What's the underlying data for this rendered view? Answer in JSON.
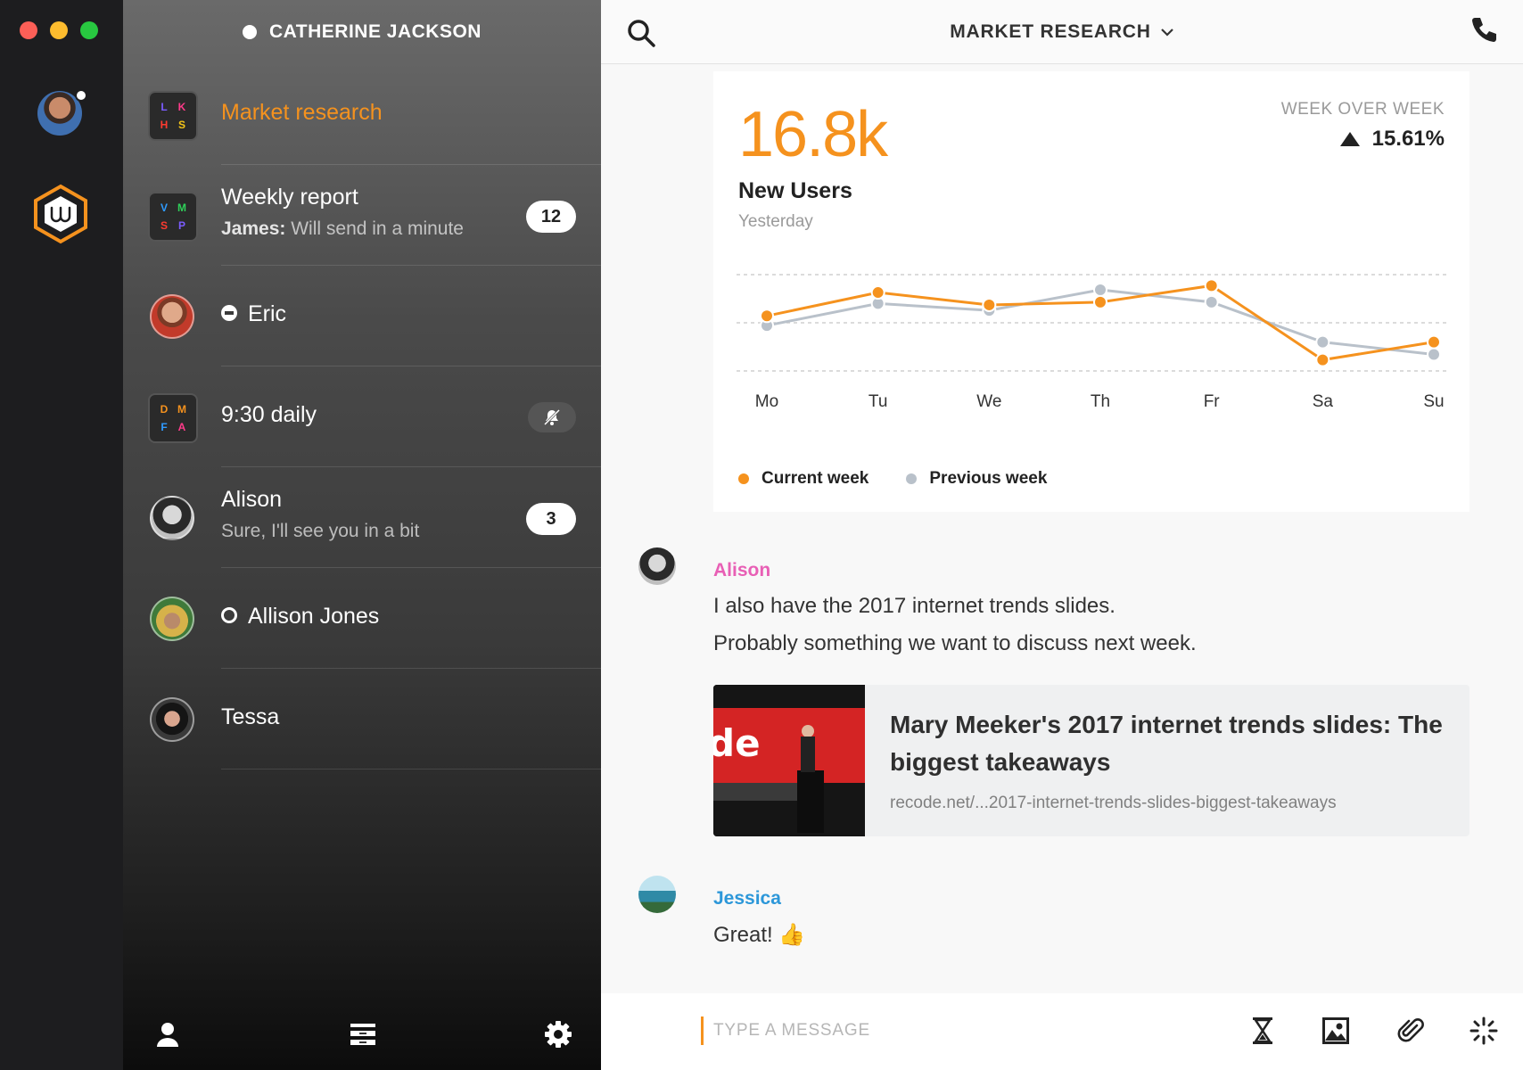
{
  "window": {
    "traffic_lights": [
      "close",
      "minimize",
      "zoom"
    ]
  },
  "rail": {
    "avatar_icon": "user-avatar",
    "logo_icon": "wire-logo-icon",
    "accent": "#f5921e"
  },
  "sidebar": {
    "header": {
      "user_name": "CATHERINE JACKSON"
    },
    "conversations": [
      {
        "type": "group",
        "title": "Market research",
        "active": true,
        "initials": [
          "L",
          "K",
          "H",
          "S"
        ],
        "initial_colors": [
          "#7b5cff",
          "#ff3b8a",
          "#ff3b30",
          "#f5c518"
        ]
      },
      {
        "type": "group",
        "title": "Weekly report",
        "sender": "James:",
        "preview": "Will send in a minute",
        "unread": "12",
        "initials": [
          "V",
          "M",
          "S",
          "P"
        ],
        "initial_colors": [
          "#2f9bff",
          "#2ed159",
          "#ff3b30",
          "#7b5cff"
        ]
      },
      {
        "type": "person",
        "title": "Eric",
        "presence": "do-not-disturb"
      },
      {
        "type": "group",
        "title": "9:30 daily",
        "muted": true,
        "initials": [
          "D",
          "M",
          "F",
          "A"
        ],
        "initial_colors": [
          "#f5921e",
          "#f5921e",
          "#2f9bff",
          "#ff3b8a"
        ]
      },
      {
        "type": "person",
        "title": "Alison",
        "preview": "Sure, I'll see you in a bit",
        "unread": "3"
      },
      {
        "type": "person",
        "title": "Allison Jones",
        "presence": "away"
      },
      {
        "type": "person",
        "title": "Tessa"
      }
    ],
    "footer": {
      "icons": [
        "person-icon",
        "archive-icon",
        "gear-icon"
      ]
    }
  },
  "main": {
    "topbar": {
      "title": "MARKET RESEARCH",
      "search_icon": "search-icon",
      "call_icon": "phone-icon"
    },
    "stats_card": {
      "metric_value": "16.8k",
      "metric_label": "New Users",
      "period": "Yesterday",
      "wow_label": "WEEK OVER WEEK",
      "wow_value": "15.61%",
      "wow_direction": "up"
    },
    "messages": [
      {
        "author": "Alison",
        "author_color": "#e85fb5",
        "lines": [
          "I also have the 2017 internet trends slides.",
          "Probably something we want to discuss next week."
        ]
      },
      {
        "author": "Jessica",
        "author_color": "#2c97d9",
        "lines": [
          "Great! 👍"
        ]
      }
    ],
    "link_preview": {
      "title": "Mary Meeker's 2017 internet trends slides: The biggest takeaways",
      "url": "recode.net/...2017-internet-trends-slides-biggest-takeaways"
    },
    "composer": {
      "placeholder": "TYPE A MESSAGE",
      "tools": [
        "timer-icon",
        "image-icon",
        "attachment-icon",
        "ping-icon"
      ]
    }
  },
  "chart_data": {
    "type": "line",
    "categories": [
      "Mo",
      "Tu",
      "We",
      "Th",
      "Fr",
      "Sa",
      "Su"
    ],
    "series": [
      {
        "name": "Current week",
        "color": "#f5921e",
        "values": [
          70,
          87,
          78,
          80,
          92,
          38,
          51
        ]
      },
      {
        "name": "Previous week",
        "color": "#b9c1ca",
        "values": [
          63,
          79,
          74,
          89,
          80,
          51,
          42
        ]
      }
    ],
    "ylim": [
      30,
      100
    ],
    "grid": true,
    "legend_position": "bottom-left",
    "title": "",
    "xlabel": "",
    "ylabel": ""
  }
}
